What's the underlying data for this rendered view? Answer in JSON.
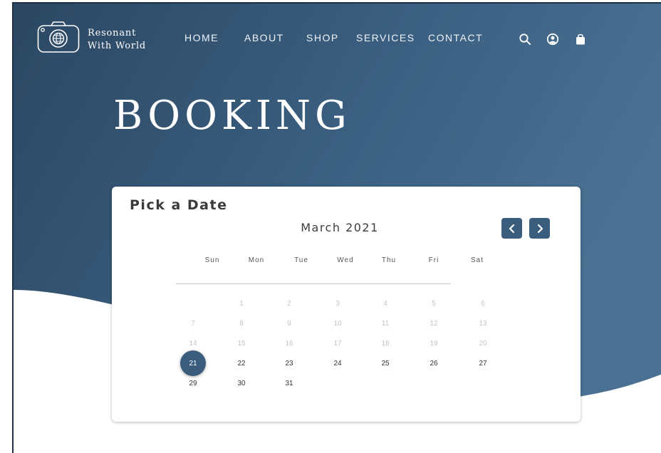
{
  "brand": {
    "line1": "Resonant",
    "line2": "With World",
    "logo_icon": "camera-globe-icon"
  },
  "nav": [
    "HOME",
    "ABOUT",
    "SHOP",
    "SERVICES",
    "CONTACT"
  ],
  "header_icons": [
    "search-icon",
    "user-icon",
    "shopping-bag-icon"
  ],
  "page_title": "BOOKING",
  "calendar": {
    "heading": "Pick a Date",
    "month_label": "March 2021",
    "prev_icon": "chevron-left-icon",
    "next_icon": "chevron-right-icon",
    "weekdays": [
      "Sun",
      "Mon",
      "Tue",
      "Wed",
      "Thu",
      "Fri",
      "Sat"
    ],
    "weeks": [
      [
        "",
        "1",
        "2",
        "3",
        "4",
        "5",
        "6"
      ],
      [
        "7",
        "8",
        "9",
        "10",
        "11",
        "12",
        "13"
      ],
      [
        "14",
        "15",
        "16",
        "17",
        "18",
        "19",
        "20"
      ],
      [
        "21",
        "22",
        "23",
        "24",
        "25",
        "26",
        "27"
      ],
      [
        "29",
        "30",
        "31",
        "",
        "",
        "",
        ""
      ]
    ],
    "disabled_through": 20,
    "selected": "21"
  },
  "colors": {
    "accent": "#3a5d7e",
    "hero_dark": "#2b4762",
    "hero_light": "#4a7193"
  }
}
